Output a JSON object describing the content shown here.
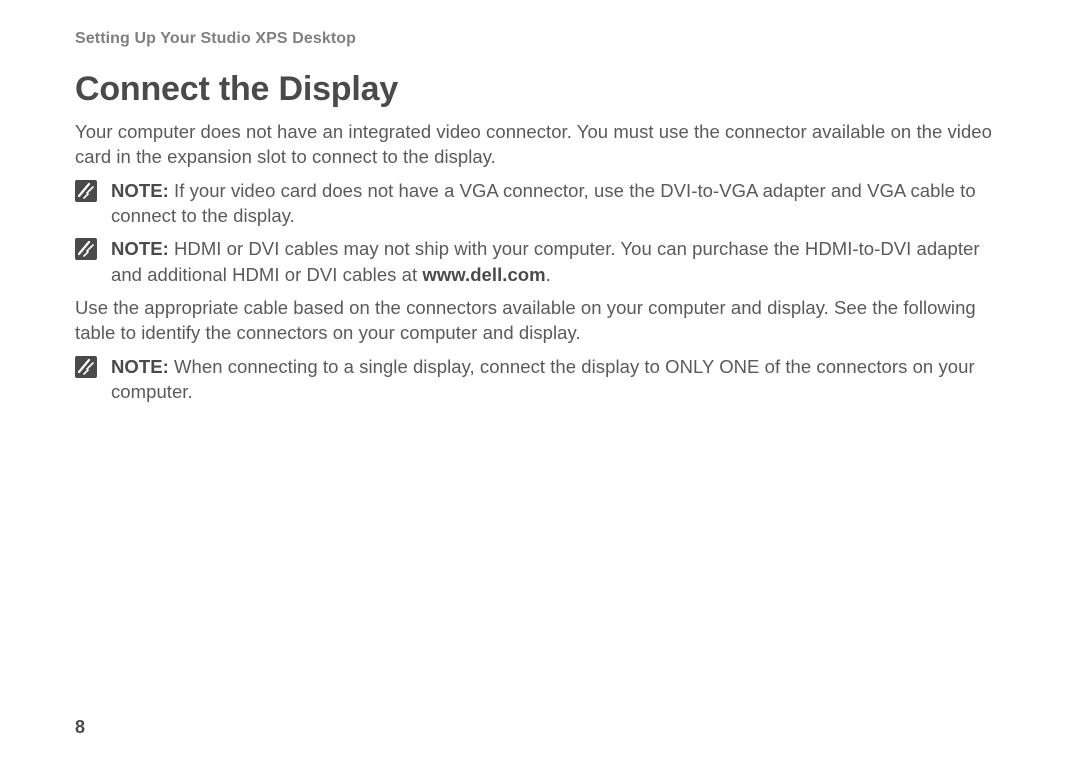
{
  "running_head": "Setting Up Your Studio XPS Desktop",
  "heading": "Connect the Display",
  "intro_paragraph": "Your computer does not have an integrated video connector. You must use the connector available on the video card in the expansion slot to connect to the display.",
  "note1": {
    "label": "NOTE:",
    "text": " If your video card does not have a VGA connector, use the DVI-to-VGA adapter and VGA cable to connect to the display."
  },
  "note2": {
    "label": "NOTE:",
    "text_before": " HDMI or DVI cables may not ship with your computer. You can purchase the HDMI-to-DVI adapter and additional HDMI or DVI cables at ",
    "link": "www.dell.com",
    "text_after": "."
  },
  "mid_paragraph": "Use the appropriate cable based on the connectors available on your computer and display. See the following table to identify the connectors on your computer and display.",
  "note3": {
    "label": "NOTE:",
    "text": " When connecting to a single display, connect the display to ONLY ONE of the connectors on your computer."
  },
  "page_number": "8"
}
